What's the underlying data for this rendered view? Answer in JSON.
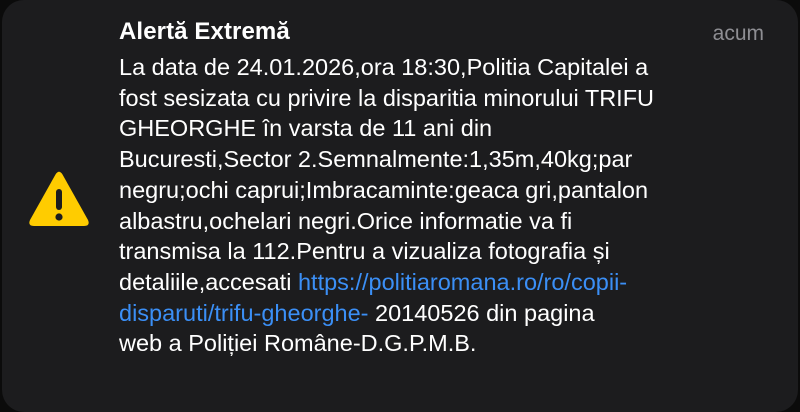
{
  "notification": {
    "title": "Alertă Extremă",
    "time": "acum",
    "icon": "warning-triangle-icon",
    "accent_color": "#ffcc00",
    "link_color": "#3b8ff6",
    "body": {
      "line1": "La data de 24.01.2026,ora 18:30,Politia Capitalei a",
      "line2": "fost sesizata cu privire la disparitia minorului TRIFU",
      "line3": "GHEORGHE în varsta de 11 ani din",
      "line4": "Bucuresti,Sector 2.Semnalmente:1,35m,40kg;par",
      "line5": "negru;ochi caprui;Imbracaminte:geaca gri,pantalon",
      "line6": "albastru,ochelari negri.Orice informatie va fi",
      "line7": "transmisa la 112.Pentru a vizualiza fotografia și",
      "line8_prefix": "detaliile,accesati ",
      "link_part1": "https://politiaromana.ro/ro/copii-",
      "link_part2": "disparuti/trifu-gheorghe-",
      "line9_suffix": " 20140526 din pagina",
      "line10": "web a Poliției Române-D.G.P.M.B."
    }
  }
}
